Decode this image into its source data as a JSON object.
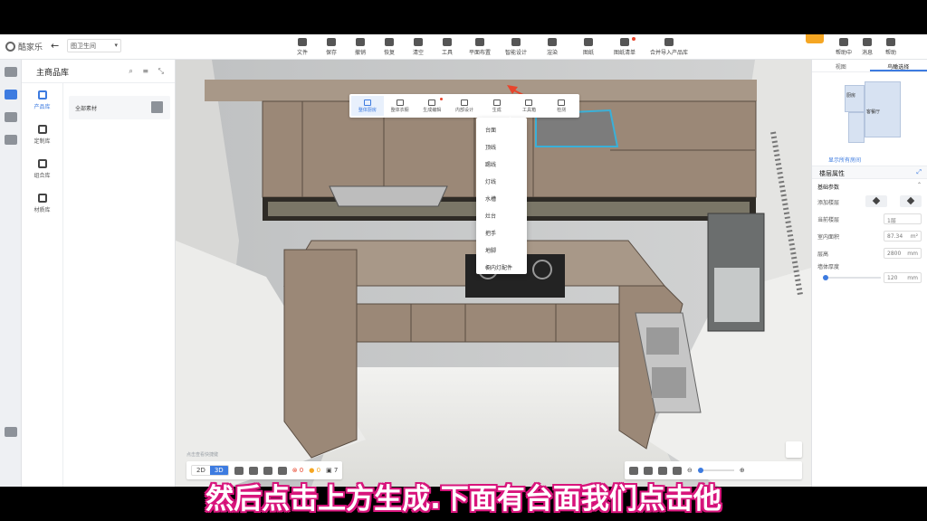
{
  "app": {
    "logo_text": "酷家乐",
    "project_name": "图卫生间",
    "back_symbol": "←"
  },
  "toolbar": {
    "items": [
      {
        "label": "文件",
        "icon": "file-icon"
      },
      {
        "label": "保存",
        "icon": "save-icon"
      },
      {
        "label": "撤销",
        "icon": "undo-icon"
      },
      {
        "label": "恢复",
        "icon": "redo-icon"
      },
      {
        "label": "清空",
        "icon": "eraser-icon"
      },
      {
        "label": "工具",
        "icon": "tool-icon"
      },
      {
        "label": "平面布置",
        "icon": "layout-icon"
      },
      {
        "label": "智能设计",
        "icon": "smart-icon"
      },
      {
        "label": "渲染",
        "icon": "camera-icon"
      },
      {
        "label": "图纸",
        "icon": "drawing-icon"
      },
      {
        "label": "图纸清单",
        "icon": "list-icon"
      },
      {
        "label": "合并导入产品库",
        "icon": "import-icon"
      }
    ],
    "right_items": [
      {
        "label": "帮助中",
        "icon": "help-icon"
      },
      {
        "label": "消息",
        "icon": "bell-icon"
      },
      {
        "label": "帮助",
        "icon": "question-icon"
      }
    ]
  },
  "left_panel": {
    "title": "主商品库",
    "categories": [
      {
        "label": "产品库",
        "active": true
      },
      {
        "label": "定制库",
        "active": false
      },
      {
        "label": "组合库",
        "active": false
      },
      {
        "label": "材质库",
        "active": false
      }
    ],
    "item_label": "全部素材"
  },
  "subtoolbar": {
    "items": [
      {
        "label": "整体厨房",
        "active": true
      },
      {
        "label": "整体衣橱",
        "active": false
      },
      {
        "label": "生成编辑",
        "active": false
      },
      {
        "label": "内部设计",
        "active": false
      },
      {
        "label": "生成",
        "active": false
      },
      {
        "label": "工具箱",
        "active": false
      },
      {
        "label": "检测",
        "active": false
      }
    ]
  },
  "dropdown": {
    "items": [
      "台面",
      "顶线",
      "踢线",
      "灯线",
      "水槽",
      "灶台",
      "把手",
      "地脚",
      "橱内灯配件"
    ]
  },
  "right_panel": {
    "tabs": [
      {
        "label": "视图",
        "active": false
      },
      {
        "label": "鸟瞰选择",
        "active": true
      }
    ],
    "minimap_caption": "显示所有房间",
    "minimap_labels": [
      "厨房",
      "客餐厅"
    ],
    "section_title": "楼层属性",
    "subsection": "基础参数",
    "rows": [
      {
        "label": "添加楼层",
        "type": "buttons"
      },
      {
        "label": "当前楼层",
        "value": "1层"
      },
      {
        "label": "室内面积",
        "value": "87.34",
        "unit": "m²"
      },
      {
        "label": "层高",
        "value": "2800",
        "unit": "mm"
      },
      {
        "label": "墙体厚度",
        "value": "120",
        "unit": "mm",
        "slider": 0.0
      }
    ]
  },
  "bottom": {
    "hint": "点击查看快捷键",
    "view_modes": [
      "2D",
      "3D"
    ],
    "active_mode": "3D",
    "errors": "0",
    "warnings": "0",
    "count": "7"
  },
  "subtitle": "然后点击上方生成.下面有台面我们点击他",
  "colors": {
    "accent": "#3d7be0",
    "subtitle_stroke": "#d8157c",
    "cabinet": "#9b8877",
    "highlight": "#3ab0d8"
  }
}
